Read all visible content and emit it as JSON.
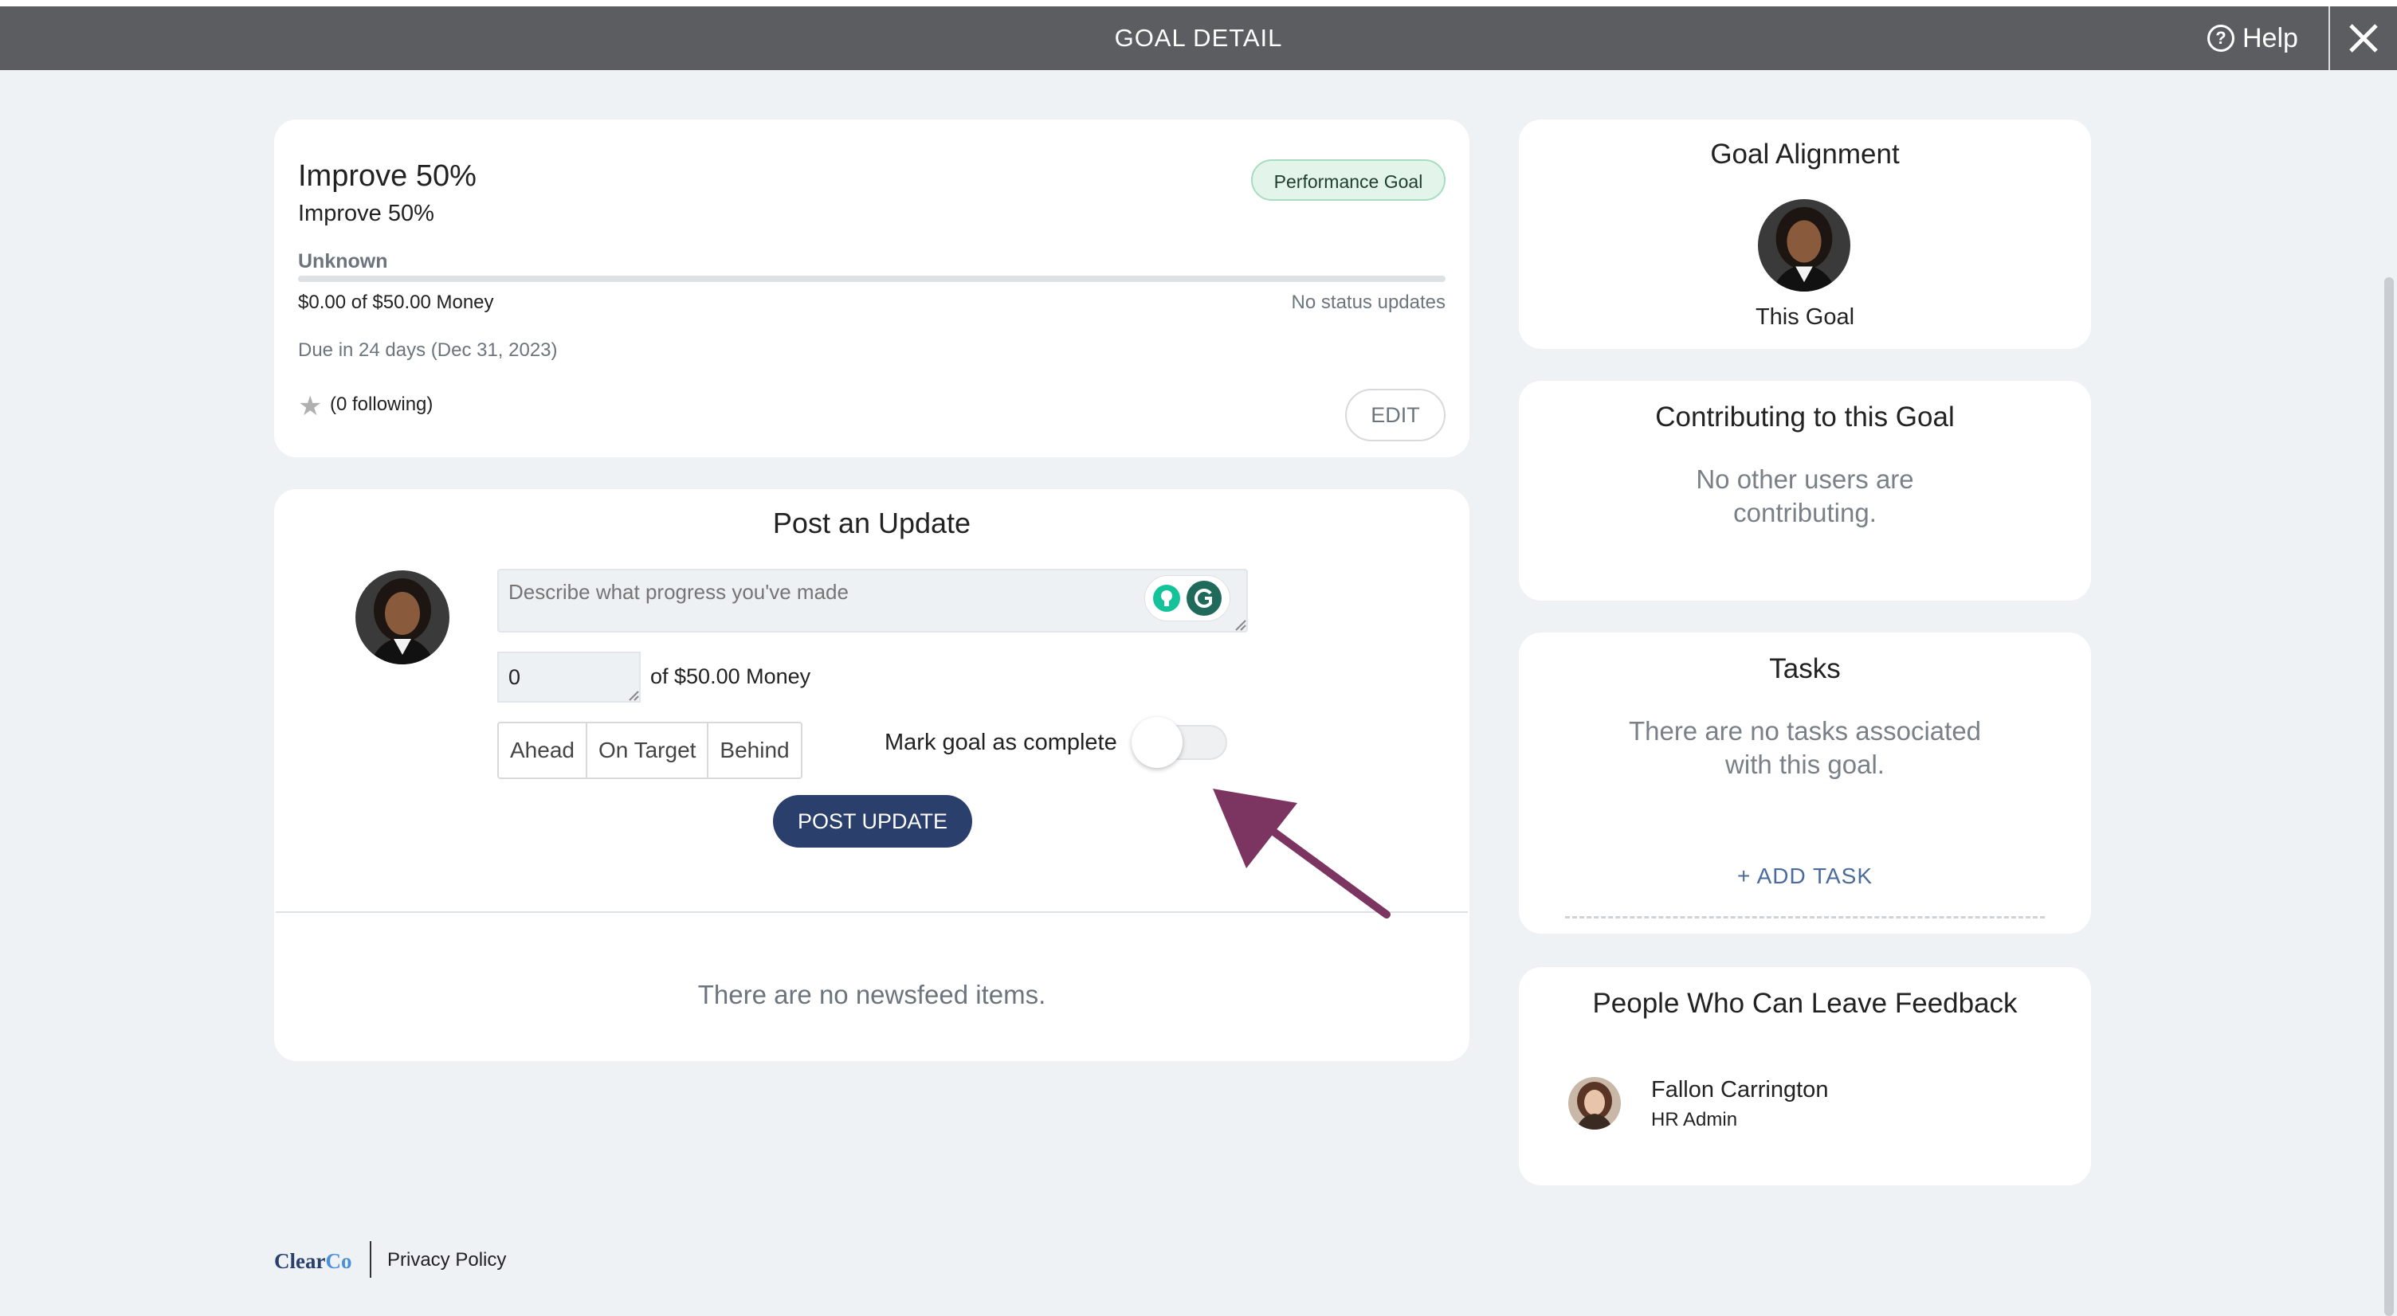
{
  "header": {
    "title": "GOAL DETAIL",
    "help_label": "Help",
    "bg_color": "#5c5d60"
  },
  "goal": {
    "title": "Improve 50%",
    "subtitle": "Improve 50%",
    "badge": "Performance Goal",
    "status_label": "Unknown",
    "progress_fraction": 0,
    "amount_text": "$0.00 of $50.00 Money",
    "status_updates": "No status updates",
    "due_text": "Due in 24 days (Dec 31, 2023)",
    "following_text": "(0 following)",
    "edit_label": "EDIT"
  },
  "post_update": {
    "title": "Post an Update",
    "input_placeholder": "Describe what progress you've made",
    "amount_value": "0",
    "amount_suffix": "of $50.00 Money",
    "status_options": [
      "Ahead",
      "On Target",
      "Behind"
    ],
    "complete_label": "Mark goal as complete",
    "complete_on": false,
    "post_button": "POST UPDATE",
    "accent_color": "#2a3f6b"
  },
  "newsfeed": {
    "empty_text": "There are no newsfeed items."
  },
  "alignment": {
    "title": "Goal Alignment",
    "label": "This Goal"
  },
  "contributing": {
    "title": "Contributing to this Goal",
    "empty_line1": "No other users are",
    "empty_line2": "contributing."
  },
  "tasks": {
    "title": "Tasks",
    "empty_line1": "There are no tasks associated",
    "empty_line2": "with this goal.",
    "add_label": "+ ADD TASK"
  },
  "feedback": {
    "title": "People Who Can Leave Feedback",
    "people": [
      {
        "name": "Fallon Carrington",
        "role": "HR Admin"
      }
    ]
  },
  "footer": {
    "logo_part1": "Clear",
    "logo_part2": "Co",
    "privacy": "Privacy Policy"
  }
}
